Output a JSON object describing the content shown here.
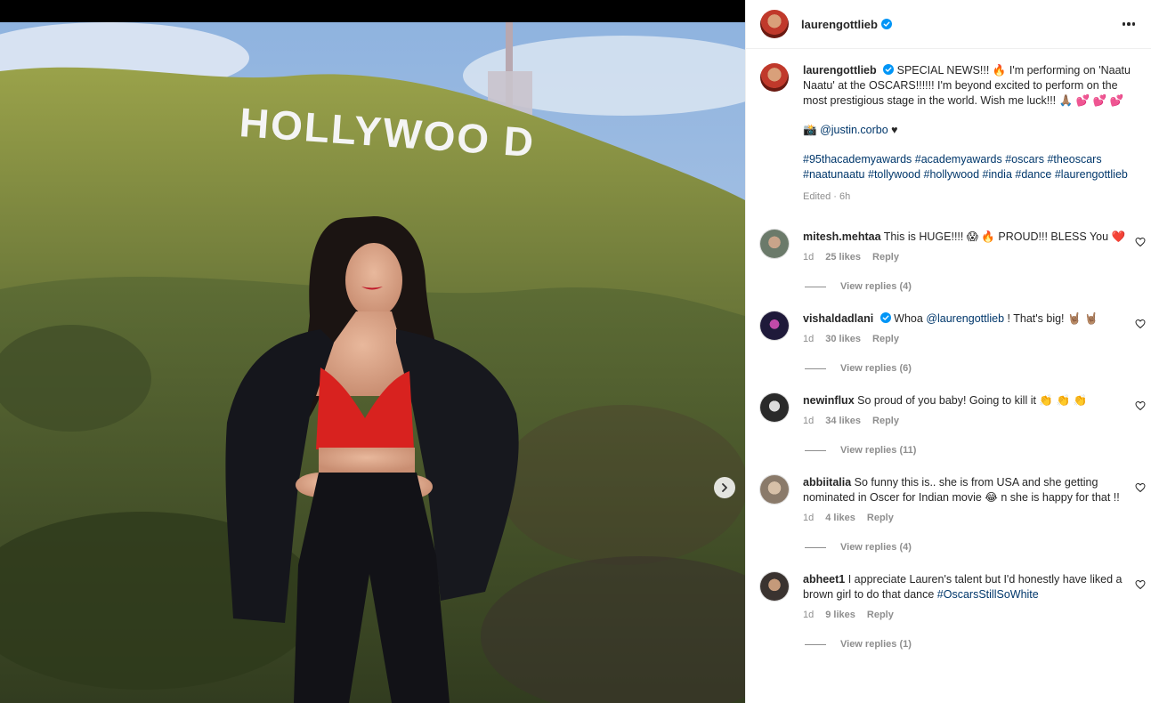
{
  "post": {
    "username": "laurengottlieb",
    "caption_text": "SPECIAL NEWS!!! 🔥 I'm performing on 'Naatu Naatu' at the OSCARS!!!!!! I'm beyond excited to perform on the most prestigious stage in the world. Wish me luck!!! 🙏🏽 💕 💕 💕",
    "credit_prefix": "📸",
    "credit_handle": "@justin.corbo",
    "credit_suffix": "♥",
    "hashtags": "#95thacademyawards #academyawards #oscars #theoscars #naatunaatu #tollywood #hollywood #india #dance #laurengottlieb",
    "edited_time": "Edited · 6h",
    "photo_sign_text": "HOLLYWOO D"
  },
  "comments": [
    {
      "user": "mitesh.mehtaa",
      "text": "This is HUGE!!!! 😱 🔥 PROUD!!! BLESS You ❤️",
      "time": "1d",
      "likes": "25 likes",
      "reply": "Reply",
      "view_replies": "View replies (4)",
      "avatar_color": "#6b7a6a"
    },
    {
      "user": "vishaldadlani",
      "verified": true,
      "text_prefix": "Whoa ",
      "mention": "@laurengottlieb",
      "text_suffix": " ! That's big! 🤘🏽 🤘🏽",
      "time": "1d",
      "likes": "30 likes",
      "reply": "Reply",
      "view_replies": "View replies (6)",
      "avatar_color": "#1f1a3a"
    },
    {
      "user": "newinflux",
      "text": "So proud of you baby! Going to kill it 👏 👏 👏",
      "time": "1d",
      "likes": "34 likes",
      "reply": "Reply",
      "view_replies": "View replies (11)",
      "avatar_color": "#2a2a2a"
    },
    {
      "user": "abbiitalia",
      "text": "So funny this is.. she is from USA and she getting nominated in Oscer for Indian movie 😂 n she is happy for that !!",
      "time": "1d",
      "likes": "4 likes",
      "reply": "Reply",
      "view_replies": "View replies (4)",
      "avatar_color": "#8a7a6a"
    },
    {
      "user": "abheet1",
      "text_prefix": "I appreciate Lauren's talent but I'd honestly have liked a brown girl to do that dance ",
      "mention": "#OscarsStillSoWhite",
      "time": "1d",
      "likes": "9 likes",
      "reply": "Reply",
      "view_replies": "View replies (1)",
      "avatar_color": "#3a3330"
    }
  ],
  "colors": {
    "link": "#00376b",
    "muted": "#8e8e8e",
    "verified": "#0095f6",
    "text": "#262626"
  }
}
